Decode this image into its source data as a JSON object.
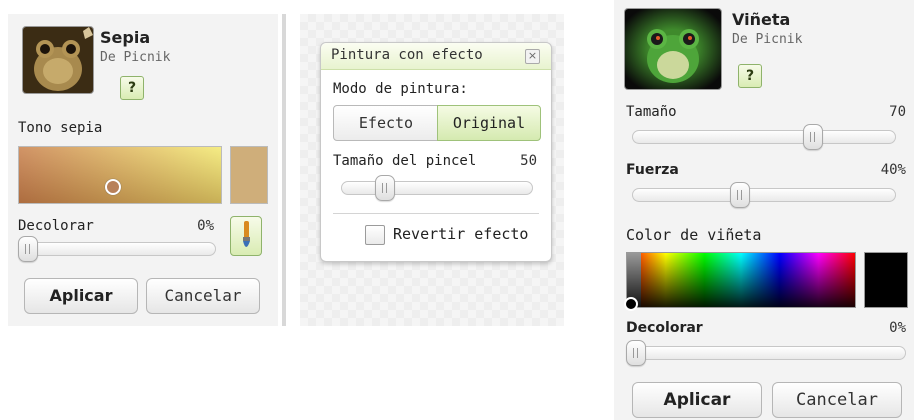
{
  "sepia_panel": {
    "title": "Sepia",
    "author": "De Picnik",
    "help": "?",
    "tone_label": "Tono sepia",
    "tone_swatch_color": "#cfae7a",
    "fade_label": "Decolorar",
    "fade_value": "0%",
    "fade_fraction": 0,
    "apply_label": "Aplicar",
    "cancel_label": "Cancelar"
  },
  "paint_dialog": {
    "title": "Pintura con efecto",
    "close_icon": "close-icon",
    "mode_label": "Modo de pintura:",
    "mode_effect": "Efecto",
    "mode_original": "Original",
    "mode_selected": "Original",
    "brush_label": "Tamaño del pincel",
    "brush_value": "50",
    "brush_fraction": 0.2,
    "revert_label": "Revertir efecto",
    "revert_checked": false
  },
  "vignette_panel": {
    "title": "Viñeta",
    "author": "De Picnik",
    "help": "?",
    "size_label": "Tamaño",
    "size_value": "70",
    "size_fraction": 0.7,
    "strength_label": "Fuerza",
    "strength_value": "40%",
    "strength_fraction": 0.4,
    "color_label": "Color de viñeta",
    "selected_color": "#000000",
    "fade_label": "Decolorar",
    "fade_value": "0%",
    "fade_fraction": 0,
    "apply_label": "Aplicar",
    "cancel_label": "Cancelar"
  },
  "colors": {
    "accent_green": "#8fb36b",
    "panel_bg": "#f3f3f3"
  }
}
